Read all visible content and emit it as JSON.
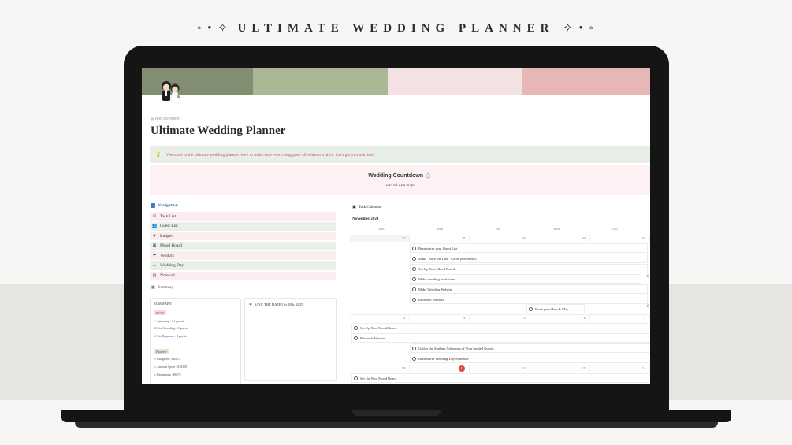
{
  "hero": {
    "ornament_left": "◦ • ✧",
    "title": "ULTIMATE WEDDING PLANNER",
    "ornament_right": "✧ • ◦"
  },
  "colors": {
    "cover": [
      "#828e71",
      "#a9b795",
      "#f3e1e3",
      "#e7b7b5"
    ],
    "callout_bg": "#e8efe7",
    "callout_text": "#c54f7a",
    "countdown_bg": "#fdf1f4",
    "nav_item_bg": [
      "#fbecef",
      "#e9f0e7",
      "#fbecef",
      "#e9f0e7",
      "#fbecef",
      "#e9f0e7",
      "#fbecef"
    ],
    "today": "#e04848"
  },
  "page": {
    "add_comment": "Add comment",
    "title": "Ultimate Wedding Planner",
    "callout": "Welcome to the ultimate wedding planner: here to make sure everything goes off without a hitch. Let's get you married!",
    "countdown_title": "Wedding Countdown 💍",
    "countdown_value": "11m 5d 21m to go"
  },
  "navigation": {
    "heading": "Navigation",
    "items": [
      {
        "label": "Task List",
        "icon": "⊡"
      },
      {
        "label": "Guest List",
        "icon": "👥"
      },
      {
        "label": "Budget",
        "icon": "❦"
      },
      {
        "label": "Mood Board",
        "icon": "▦"
      },
      {
        "label": "Vendors",
        "icon": "☂"
      },
      {
        "label": "Wedding Day",
        "icon": "〰"
      },
      {
        "label": "Notepad",
        "icon": "▤"
      }
    ],
    "summary_link": "Summary"
  },
  "summary_card": {
    "title": "SUMMARY",
    "rsvp_tag": "RSVP",
    "attending": "✓ Attending : 21 guests",
    "not_attending": "☒ Not Attending : 0 guests",
    "no_response": "☐ No Response : 4 guests",
    "expense_tag": "Expense",
    "budgeted": "▷ Budgeted : $46875",
    "spent": "▷ Amount Spent : $38300",
    "remaining": "▷ Remaining : $8575"
  },
  "save_date": {
    "text": "SAVE THE DATE Oct 18th, 2025"
  },
  "calendar": {
    "heading": "Task Calendar",
    "month": "November 2024",
    "days": [
      "Sun",
      "Mon",
      "Tue",
      "Wed",
      "Thu"
    ],
    "week1_dates": [
      "27",
      "28",
      "29",
      "30",
      "31"
    ],
    "week2_dates": [
      "3",
      "4",
      "5",
      "6",
      "7"
    ],
    "week3_dates": [
      "10",
      "11",
      "12",
      "13",
      "14"
    ],
    "week1_events": [
      "Brainstorm your Guest List",
      "Make \"Save the Date\" Cards (electronic)",
      "Set Up Your Mood Board",
      "Make wedding invitations",
      "Make Wedding Website",
      "Research Vendors"
    ],
    "week1_event_wed": "Book your Hair & Mak...",
    "week2_events": [
      "Set Up Your Mood Board",
      "Research Vendors",
      "Gather the Mailing Addresses of Your Invited Guests",
      "Brainstorm Wedding Day Schedule"
    ],
    "week3_events": [
      "Set Up Your Mood Board"
    ]
  }
}
